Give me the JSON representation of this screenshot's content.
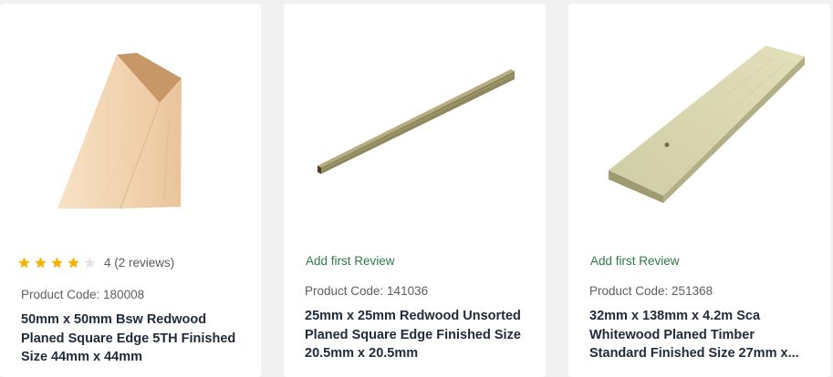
{
  "products": [
    {
      "image_icon": "square-timber-post-image",
      "rating_value": 4,
      "rating_max": 5,
      "review_text": "4 (2 reviews)",
      "product_code": "Product Code: 180008",
      "title": "50mm x 50mm Bsw Redwood Planed Square Edge 5TH Finished Size 44mm x 44mm"
    },
    {
      "image_icon": "thin-timber-batten-image",
      "add_review_label": "Add first Review",
      "product_code": "Product Code: 141036",
      "title": "25mm x 25mm Redwood Unsorted Planed Square Edge Finished Size 20.5mm x 20.5mm"
    },
    {
      "image_icon": "timber-plank-image",
      "add_review_label": "Add first Review",
      "product_code": "Product Code: 251368",
      "title": "32mm x 138mm x 4.2m Sca Whitewood Planed Timber Standard Finished Size 27mm x..."
    }
  ],
  "colors": {
    "star_filled": "#f5b301",
    "star_empty": "#e4e4e4",
    "review_link": "#2f7a45",
    "title": "#1f2a3a"
  }
}
